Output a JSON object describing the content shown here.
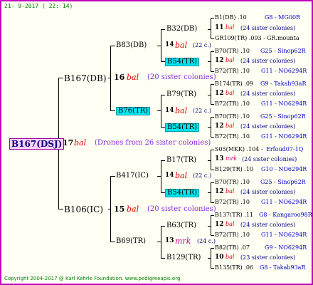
{
  "header": "21-  9-2017 ( 22: 14)",
  "footer": "Copyright 2004-2017 @ Karl Kehrle Foundation.   www.pedigreeapis.org",
  "root": {
    "label": "B167(DSJ)",
    "gen": "17",
    "mark": "bal",
    "note": "(Drones from 26 sister colonies)"
  },
  "l1": [
    {
      "label": "B167(DB)",
      "gen": "16",
      "mark": "bal",
      "note": "(20 sister colonies)"
    },
    {
      "label": "B106(IC)",
      "gen": "15",
      "mark": "bal",
      "note": "(20 sister colonies)"
    }
  ],
  "l2": [
    {
      "label": "B83(DB)",
      "gen": "14",
      "mark": "bal",
      "note": "(22 c.)"
    },
    {
      "label": "B76(TR)",
      "gen": "14",
      "mark": "bal",
      "note": "(22 c.)"
    },
    {
      "label": "B417(IC)",
      "gen": "14",
      "mark": "bal",
      "note": "(22 c.)"
    },
    {
      "label": "B69(TR)",
      "gen": "13",
      "mark": "mrk",
      "note": "(24 c.)"
    }
  ],
  "l3": [
    {
      "label": "B32(DB)",
      "gen": "11",
      "mark": "bal",
      "note": "(24 sister colonies)"
    },
    {
      "label": "B54(TR)",
      "gen": "12",
      "mark": "bal",
      "note": "(24 sister colonies)"
    },
    {
      "label": "B79(TR)",
      "gen": "12",
      "mark": "bal",
      "note": "(24 sister colonies)"
    },
    {
      "label": "B54(TR)",
      "gen": "12",
      "mark": "bal",
      "note": "(24 sister colonies)"
    },
    {
      "label": "B17(TR)",
      "gen": "13",
      "mark": "mrk",
      "note": "(24 sister colonies)"
    },
    {
      "label": "B54(TR)",
      "gen": "12",
      "mark": "bal",
      "note": "(24 sister colonies)"
    },
    {
      "label": "B63(TR)",
      "gen": "12",
      "mark": "bal",
      "note": "(24 sister colonies)"
    },
    {
      "label": "B129(TR)",
      "gen": "10",
      "mark": "bal",
      "note": "(23 sister colonies)"
    }
  ],
  "l4": [
    {
      "left": "B1(DB) .10",
      "right": "G8 - MG00R"
    },
    {
      "left": "GR109(TR) .093 -",
      "right": "GR.mounta"
    },
    {
      "left": "B70(TR) .10",
      "right": "G25 - Sinop62R"
    },
    {
      "left": "B72(TR) .10",
      "right": "G11 - NO6294R"
    },
    {
      "left": "B174(TR) .09",
      "right": "G9 - Takab93aR"
    },
    {
      "left": "B72(TR) .10",
      "right": "G11 - NO6294R"
    },
    {
      "left": "B70(TR) .10",
      "right": "G25 - Sinop62R"
    },
    {
      "left": "B72(TR) .10",
      "right": "G11 - NO6294R"
    },
    {
      "left": "S05(MKK) .104 -",
      "right": "Erfoud07-1Q"
    },
    {
      "left": "B129(TR) .10",
      "right": "G10 - NO6294R"
    },
    {
      "left": "B70(TR) .10",
      "right": "G25 - Sinop62R"
    },
    {
      "left": "B72(TR) .10",
      "right": "G11 - NO6294R"
    },
    {
      "left": "B137(TR) .11",
      "right": "G8 - Kangaroo98R"
    },
    {
      "left": "B72(TR) .10",
      "right": "G11 - NO6294R"
    },
    {
      "left": "B82(TR) .07",
      "right": "G9 - NO6294R"
    },
    {
      "left": "B135(TR) .06",
      "right": "G8 - Takab93aR"
    }
  ]
}
